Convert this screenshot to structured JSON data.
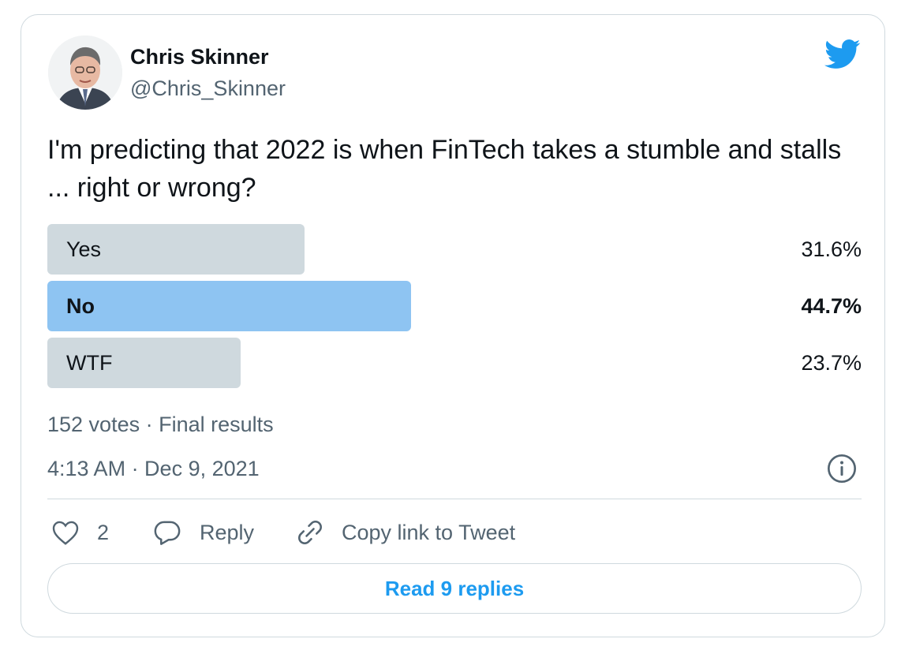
{
  "author": {
    "name": "Chris Skinner",
    "handle": "@Chris_Skinner"
  },
  "tweet": {
    "text": "I'm predicting that 2022 is when FinTech takes a stumble and stalls ... right or wrong?"
  },
  "poll": {
    "options": [
      {
        "label": "Yes",
        "percent_text": "31.6%",
        "percent": 31.6,
        "winner": false
      },
      {
        "label": "No",
        "percent_text": "44.7%",
        "percent": 44.7,
        "winner": true
      },
      {
        "label": "WTF",
        "percent_text": "23.7%",
        "percent": 23.7,
        "winner": false
      }
    ],
    "summary": "152 votes · Final results"
  },
  "timestamp": "4:13 AM · Dec 9, 2021",
  "actions": {
    "likes": "2",
    "reply_label": "Reply",
    "copy_link_label": "Copy link to Tweet"
  },
  "read_replies_label": "Read 9 replies",
  "colors": {
    "accent": "#1d9bf0",
    "winner_bar": "#8ec4f2",
    "bar": "#cfd9de",
    "secondary_text": "#536471"
  },
  "icons": [
    "twitter-bird-icon",
    "info-icon",
    "heart-icon",
    "reply-icon",
    "link-icon"
  ]
}
